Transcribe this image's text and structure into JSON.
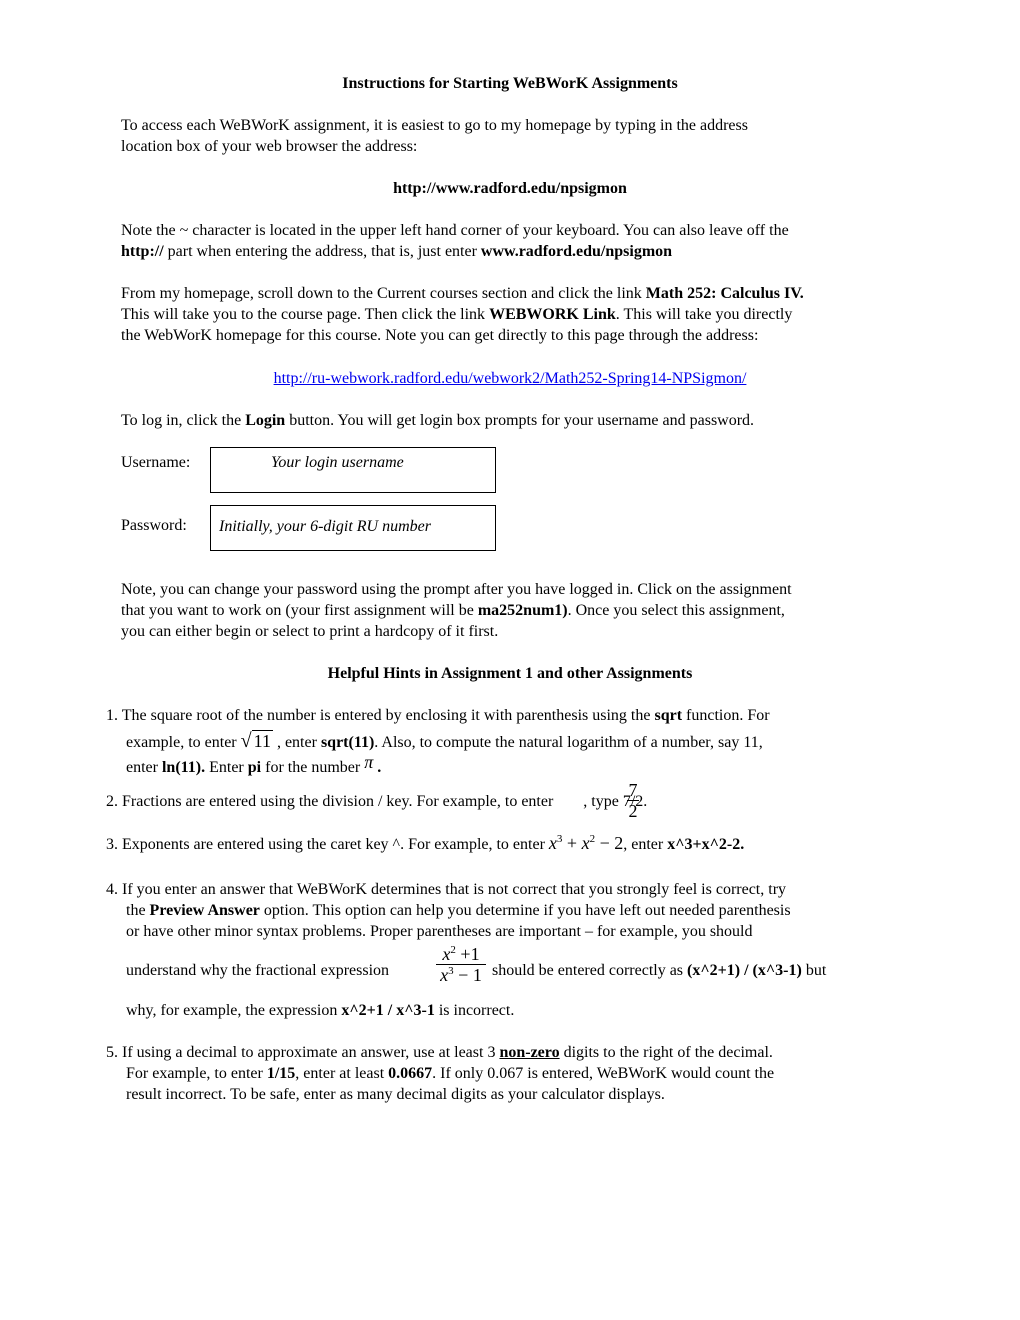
{
  "title": "Instructions for Starting WeBWorK Assignments",
  "intro": {
    "line1": "To access each WeBWorK assignment, it is easiest to go to my homepage by typing in the address",
    "line2": "location box of your web browser the address:"
  },
  "homepage_url": "http://www.radford.edu/npsigmon",
  "note_tilde": {
    "line1": "Note the ~ character is located in the upper left hand corner of your keyboard. You can also leave off the",
    "line2_bold1": "http://",
    "line2_text": " part when entering the address, that is, just enter ",
    "line2_bold2": "www.radford.edu/npsigmon"
  },
  "from_homepage": {
    "line1_text": "From my homepage, scroll down to the Current courses section and click the link ",
    "line1_bold": "Math 252: Calculus IV.",
    "line2_text1": "This will take you to the course page. Then click the link ",
    "line2_bold": "WEBWORK Link",
    "line2_text2": ". This will take you directly",
    "line3": "the WebWorK homepage for this course. Note you can get directly to this page through the address:"
  },
  "course_url": "http://ru-webwork.radford.edu/webwork2/Math252-Spring14-NPSigmon/",
  "login": {
    "text1": "To log in, click the ",
    "bold": "Login",
    "text2": " button. You will get login box prompts for your username and password."
  },
  "username": {
    "label": "Username:",
    "value": "Your login username"
  },
  "password": {
    "label": "Password:",
    "value": "Initially, your 6-digit RU number"
  },
  "note_password": {
    "line1": "Note, you can change your password using the prompt after you have logged in. Click on the assignment",
    "line2_text1": "that you want to work on  (your first assignment will be ",
    "line2_bold": "ma252num1)",
    "line2_text2": ". Once you select this assignment,",
    "line3": "you can either begin or select to print a hardcopy of it first."
  },
  "hints_title": "Helpful Hints in Assignment 1 and other Assignments",
  "hints": {
    "h1": {
      "line1_text": "1. The square root of the number is entered by enclosing it with parenthesis using the ",
      "line1_bold": "sqrt",
      "line1_text2": " function. For",
      "line2_text1": "example, to enter ",
      "sqrt_arg": "11",
      "line2_text2": " , enter ",
      "line2_bold": "sqrt(11)",
      "line2_text3": ". Also, to compute the natural logarithm of a number, say 11,",
      "line3_text1": "enter ",
      "line3_bold1": "ln(11).",
      "line3_text2": "  Enter ",
      "line3_bold2": "pi",
      "line3_text3": " for the number ",
      "pi_symbol": "π",
      "line3_end": " ."
    },
    "h2": {
      "text1": "2. Fractions are entered using the division / key. For example, to enter ",
      "frac_num": "7",
      "frac_den": "2",
      "text2": " , type 7/2."
    },
    "h3": {
      "text1": "3. Exponents are entered using the caret key ^. For example, to enter ",
      "math": {
        "t1": "x",
        "e1": "3",
        "op1": " + ",
        "t2": "x",
        "e2": "2",
        "op2": " − 2"
      },
      "text2": ", enter  ",
      "bold": "x^3+x^2-2."
    },
    "h4": {
      "line1": "4. If you enter an answer that WeBWorK determines that is not correct that you strongly feel is correct, try",
      "line2_text1": "the ",
      "line2_bold": "Preview Answer",
      "line2_text2": " option. This option can help you determine if you have left out needed parenthesis",
      "line3": "or have other minor syntax problems. Proper parentheses are important – for example, you should",
      "line4_text1": "understand why the fractional expression",
      "frac_num": {
        "x": "x",
        "e": "2",
        "rest": " +1"
      },
      "frac_den": {
        "x": "x",
        "e": "3",
        "rest": " − 1"
      },
      "line4_text2": "should be entered correctly as ",
      "line4_bold": "(x^2+1) / (x^3-1)",
      "line4_text3": " but",
      "line5_text1": "why, for example, the expression ",
      "line5_bold": "x^2+1 /  x^3-1",
      "line5_text2": "  is incorrect."
    },
    "h5": {
      "line1_text1": "5. If using a decimal to approximate an answer, use at least 3 ",
      "line1_bold": "non-zero",
      "line1_text2": " digits to the right of the decimal.",
      "line2_text1": "For example, to enter ",
      "line2_bold1": "1/15",
      "line2_text2": ", enter at least ",
      "line2_bold2": "0.0667",
      "line2_text3": ". If only 0.067 is entered, WeBWorK would count the",
      "line3": "result incorrect. To be safe, enter as many decimal digits as your calculator displays."
    }
  },
  "colors": {
    "link": "#0000ee",
    "text": "#000000"
  }
}
